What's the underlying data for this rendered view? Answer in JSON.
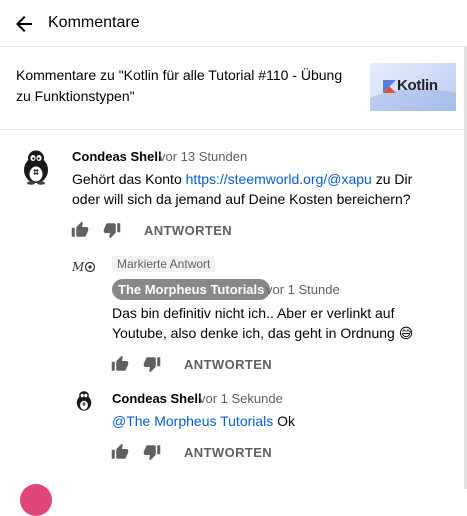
{
  "header": {
    "title": "Kommentare"
  },
  "context": {
    "text": "Kommentare zu \"Kotlin für alle Tutorial #110 - Übung zu Funktionstypen\"",
    "thumbnail_text": "Kotlin"
  },
  "comments": [
    {
      "author": "Condeas Shell",
      "time": "vor 13 Stunden",
      "text_before": "Gehört das Konto ",
      "link": "https://steemworld.org/@xapu",
      "text_after": " zu Dir oder will sich da jemand auf Deine Kosten bereichern?",
      "reply_label": "ANTWORTEN"
    }
  ],
  "replies": [
    {
      "marked_label": "Markierte Antwort",
      "author": "The Morpheus Tutorials",
      "time": "vor 1 Stunde",
      "text": "Das bin definitiv nicht ich.. Aber er verlinkt auf Youtube, also denke ich, das geht in Ordnung 😅",
      "reply_label": "ANTWORTEN"
    },
    {
      "author": "Condeas Shell",
      "time": "vor 1 Sekunde",
      "mention": "@The Morpheus Tutorials",
      "text_after": " Ok",
      "reply_label": "ANTWORTEN"
    }
  ],
  "colors": {
    "link": "#065fd4",
    "badge_bg": "#888888",
    "secondary_text": "#606060"
  }
}
